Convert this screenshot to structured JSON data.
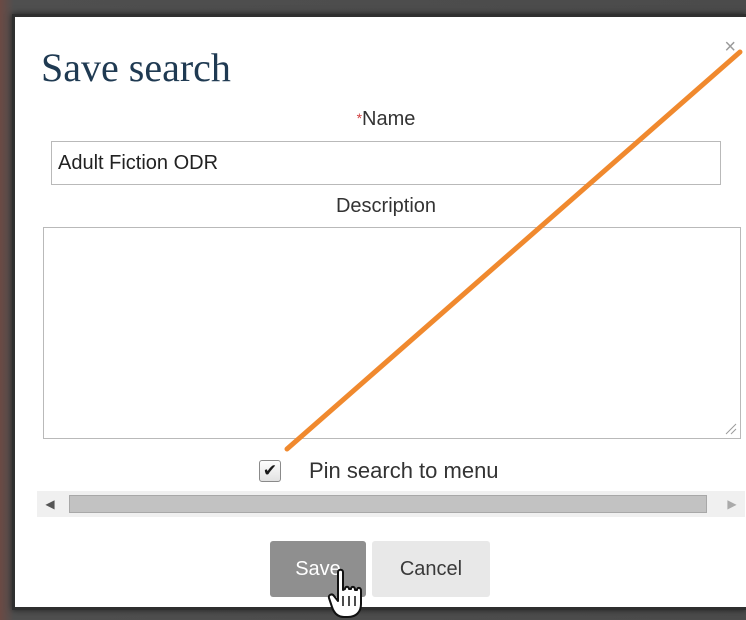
{
  "dialog": {
    "title": "Save search",
    "close_glyph": "×",
    "name_required_mark": "*",
    "name_label": "Name",
    "name_value": "Adult Fiction ODR",
    "description_label": "Description",
    "description_value": "",
    "pin_checked": true,
    "pin_checkmark": "✔",
    "pin_label": "Pin search to menu",
    "save_label": "Save",
    "cancel_label": "Cancel"
  },
  "scrollbar": {
    "left_arrow": "◀",
    "right_arrow": "▶"
  },
  "annotation": {
    "arrow_color": "#f0892e",
    "icon": "pointer-hand-icon"
  },
  "colors": {
    "title": "#1f3a52",
    "required": "#d04040",
    "save_bg": "#8f8f8f",
    "cancel_bg": "#e8e8e8"
  }
}
